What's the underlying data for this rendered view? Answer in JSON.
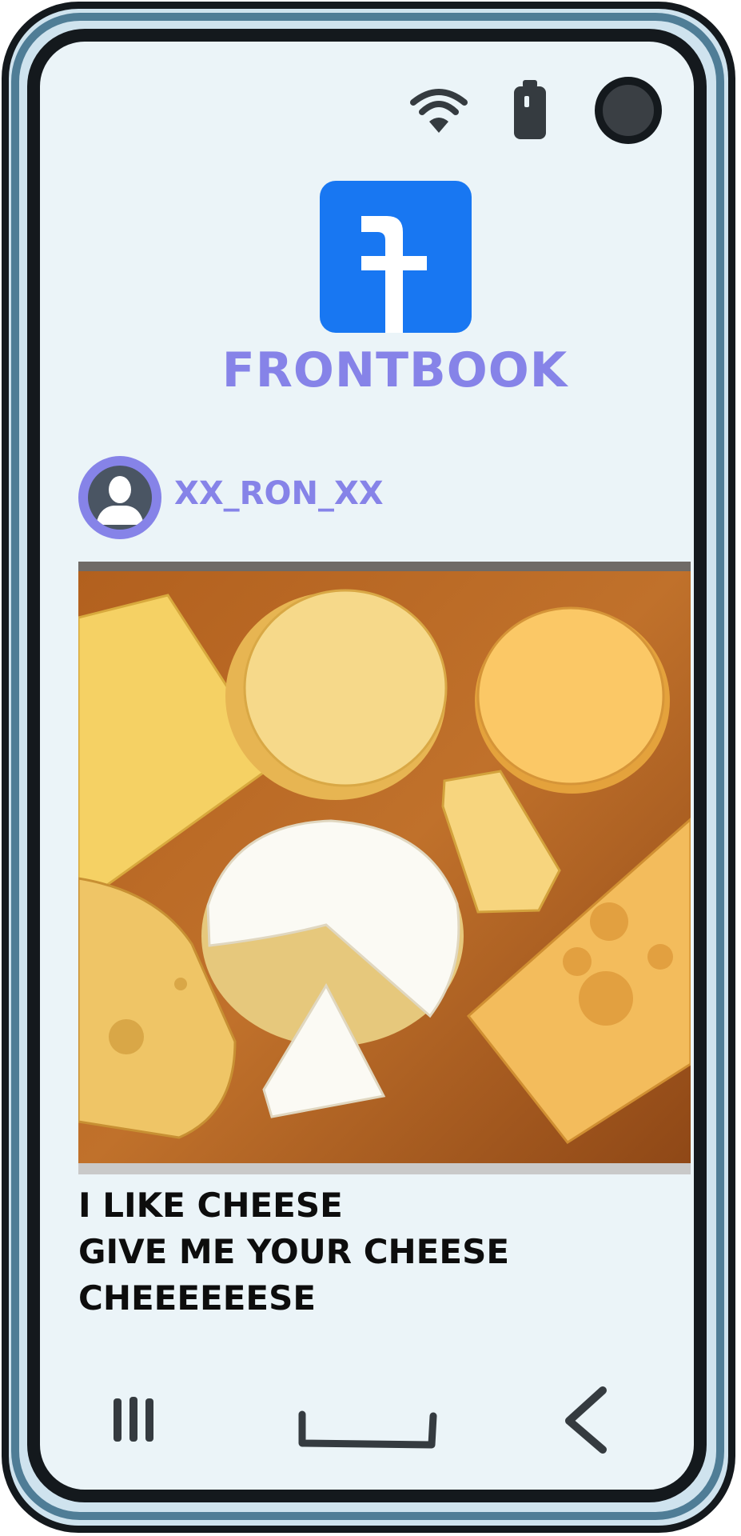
{
  "status_bar": {
    "icons": [
      "wifi-icon",
      "battery-icon",
      "front-camera"
    ]
  },
  "app": {
    "logo_icon": "frontbook-f-logo",
    "name": "FRONTBOOK",
    "brand_color": "#1877f2",
    "accent_color": "#8683e8"
  },
  "post": {
    "username": "XX_RON_XX",
    "avatar_icon": "user-silhouette-icon",
    "image_subject": "cheese-board-photo",
    "caption_lines": [
      "I LIKE CHEESE",
      "GIVE ME YOUR CHEESE",
      "CHEEEEEESE"
    ]
  },
  "nav_bar": {
    "icons": [
      "recents-icon",
      "home-icon",
      "back-icon"
    ]
  }
}
